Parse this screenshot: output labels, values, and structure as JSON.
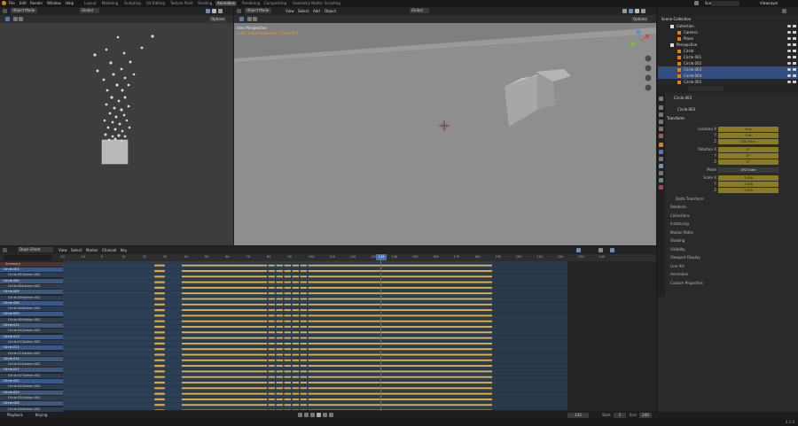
{
  "app": {
    "menus": [
      "File",
      "Edit",
      "Render",
      "Window",
      "Help"
    ],
    "workspaces": [
      "Layout",
      "Modeling",
      "Sculpting",
      "UV Editing",
      "Texture Paint",
      "Shading",
      "Animation",
      "Rendering",
      "Compositing",
      "Geometry Nodes",
      "Scripting"
    ],
    "active_workspace": "Animation",
    "scene_label": "Scene",
    "viewlayer_label": "ViewLayer",
    "version": "4.1.0"
  },
  "left_viewport": {
    "mode": "Object Mode",
    "orientation": "Global",
    "options": "Options"
  },
  "right_viewport": {
    "mode": "Object Mode",
    "menus": [
      "View",
      "Select",
      "Add",
      "Object"
    ],
    "orientation": "Global",
    "options": "Options",
    "perspective": "User Perspective",
    "collection_path": "(143) Scene Collection | Circle.003"
  },
  "outliner": {
    "title": "Scene Collection",
    "rows": [
      {
        "label": "Collection",
        "level": 1,
        "selected": false
      },
      {
        "label": "Camera",
        "level": 2,
        "selected": false
      },
      {
        "label": "Plane",
        "level": 2,
        "selected": false
      },
      {
        "label": "Persepctive",
        "level": 1,
        "selected": false
      },
      {
        "label": "Circle",
        "level": 2,
        "selected": false
      },
      {
        "label": "Circle.001",
        "level": 2,
        "selected": false
      },
      {
        "label": "Circle.002",
        "level": 2,
        "selected": false
      },
      {
        "label": "Circle.003",
        "level": 2,
        "selected": true
      },
      {
        "label": "Circle.004",
        "level": 2,
        "selected": true
      },
      {
        "label": "Circle.005",
        "level": 2,
        "selected": false
      }
    ]
  },
  "properties": {
    "object_name": "Circle.003",
    "data_name": "Circle.003",
    "transform_label": "Transform",
    "location_label": "Location X",
    "location": [
      "0 m",
      "0 m",
      "100.76 m"
    ],
    "rotation_label": "Rotation X",
    "rotation": [
      "0°",
      "0°",
      "0°"
    ],
    "mode_label": "Mode",
    "mode_value": "XYZ Euler",
    "scale_label": "Scale X",
    "scale": [
      "1.000",
      "1.000",
      "1.000"
    ],
    "axis_y": "Y",
    "axis_z": "Z",
    "delta_label": "Delta Transform",
    "panels": [
      "Relations",
      "Collections",
      "Instancing",
      "Motion Paths",
      "Shading",
      "Visibility",
      "Viewport Display",
      "Line Art",
      "Animation",
      "Custom Properties"
    ]
  },
  "dopesheet": {
    "editor": "Dope Sheet",
    "menus": [
      "View",
      "Select",
      "Marker",
      "Channel",
      "Key"
    ],
    "summary": "Summary",
    "channels": [
      {
        "label": "Circle.003",
        "type": "obj"
      },
      {
        "label": "Circle.003Action.002",
        "type": "act"
      },
      {
        "label": "Circle.004",
        "type": "obj"
      },
      {
        "label": "Circle.004Action.002",
        "type": "act"
      },
      {
        "label": "Circle.005",
        "type": "obj"
      },
      {
        "label": "Circle.005Action.002",
        "type": "act"
      },
      {
        "label": "Circle.006",
        "type": "obj"
      },
      {
        "label": "Circle.006Action.002",
        "type": "act"
      },
      {
        "label": "Circle.009",
        "type": "obj"
      },
      {
        "label": "Circle.009Action.002",
        "type": "act"
      },
      {
        "label": "Circle.012",
        "type": "obj"
      },
      {
        "label": "Circle.012Action.002",
        "type": "act"
      },
      {
        "label": "Circle.013",
        "type": "obj"
      },
      {
        "label": "Circle.013Action.002",
        "type": "act"
      },
      {
        "label": "Circle.011",
        "type": "obj"
      },
      {
        "label": "Circle.011Action.002",
        "type": "act"
      },
      {
        "label": "Circle.014",
        "type": "obj"
      },
      {
        "label": "Circle.014Action.002",
        "type": "act"
      },
      {
        "label": "Circle.017",
        "type": "obj"
      },
      {
        "label": "Circle.017Action.002",
        "type": "act"
      },
      {
        "label": "Circle.020",
        "type": "obj"
      },
      {
        "label": "Circle.020Action.002",
        "type": "act"
      },
      {
        "label": "Circle.024",
        "type": "obj"
      },
      {
        "label": "Circle.024Action.002",
        "type": "act"
      },
      {
        "label": "Circle.026",
        "type": "obj"
      },
      {
        "label": "Circle.026Action.002",
        "type": "act"
      }
    ],
    "ruler": [
      "-20",
      "-10",
      "0",
      "10",
      "20",
      "30",
      "40",
      "50",
      "60",
      "70",
      "80",
      "90",
      "100",
      "110",
      "120",
      "130",
      "140",
      "150",
      "160",
      "170",
      "180",
      "190",
      "200",
      "210",
      "220",
      "230",
      "240"
    ],
    "current_frame": "143"
  },
  "timeline": {
    "playback": "Playback",
    "keying": "Keying",
    "frame_field": "143",
    "start_label": "Start",
    "start": "1",
    "end_label": "End",
    "end": "240"
  }
}
